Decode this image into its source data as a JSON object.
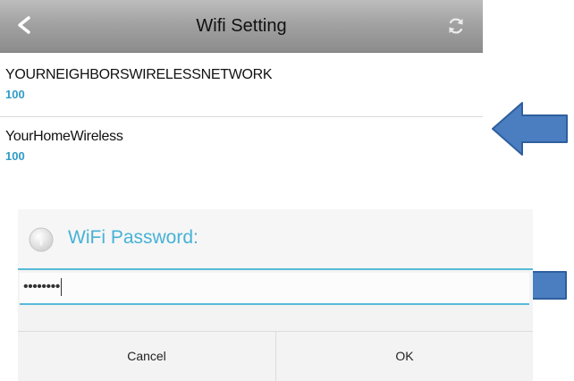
{
  "header": {
    "title": "Wifi Setting",
    "back_icon": "chevron-left-icon",
    "refresh_icon": "refresh-icon"
  },
  "networks": [
    {
      "name": "YOURNEIGHBORSWIRELESSNETWORK",
      "signal": "100"
    },
    {
      "name": "YourHomeWireless",
      "signal": "100"
    }
  ],
  "dialog": {
    "title": "WiFi Password:",
    "icon": "info-icon",
    "password_value": "••••••••",
    "cancel_label": "Cancel",
    "ok_label": "OK"
  },
  "colors": {
    "accent": "#46b2d6",
    "signal": "#2f9cc8",
    "arrow": "#4a7ec0"
  }
}
